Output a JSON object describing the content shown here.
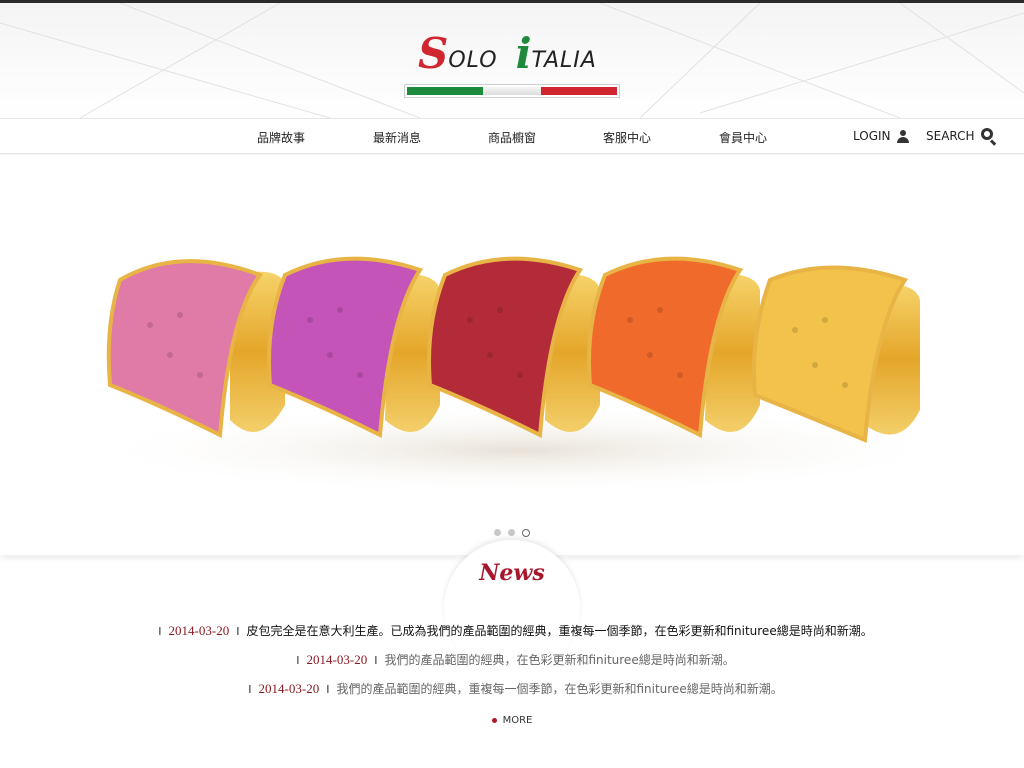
{
  "brand": {
    "logo_first_letter": "S",
    "logo_first_rest": "OLO",
    "logo_second_letter": "i",
    "logo_second_rest": "TALIA",
    "flag_colors": [
      "#1d8b3b",
      "#eeeeee",
      "#d0262f"
    ]
  },
  "nav": {
    "items": [
      {
        "label": "品牌故事"
      },
      {
        "label": "最新消息"
      },
      {
        "label": "商品櫥窗"
      },
      {
        "label": "客服中心"
      },
      {
        "label": "會員中心"
      }
    ],
    "login_label": "LOGIN",
    "search_label": "SEARCH"
  },
  "hero": {
    "image_icon": "bracelets-photo",
    "bracelet_colors": [
      "#e07aa6",
      "#c554b8",
      "#b32b39",
      "#f06a2c",
      "#f2c24a"
    ],
    "slide_count": 3,
    "active_slide": 3
  },
  "news": {
    "title": "News",
    "items": [
      {
        "date": "2014-03-20",
        "text": "皮包完全是在意大利生產。已成為我們的產品範圍的經典，重複每一個季節，在色彩更新和finituree總是時尚和新潮。"
      },
      {
        "date": "2014-03-20",
        "text": "我們的產品範圍的經典，在色彩更新和finituree總是時尚和新潮。"
      },
      {
        "date": "2014-03-20",
        "text": "我們的產品範圍的經典，重複每一個季節，在色彩更新和finituree總是時尚和新潮。"
      }
    ],
    "more_label": "MORE",
    "accent_color": "#a8182c"
  }
}
